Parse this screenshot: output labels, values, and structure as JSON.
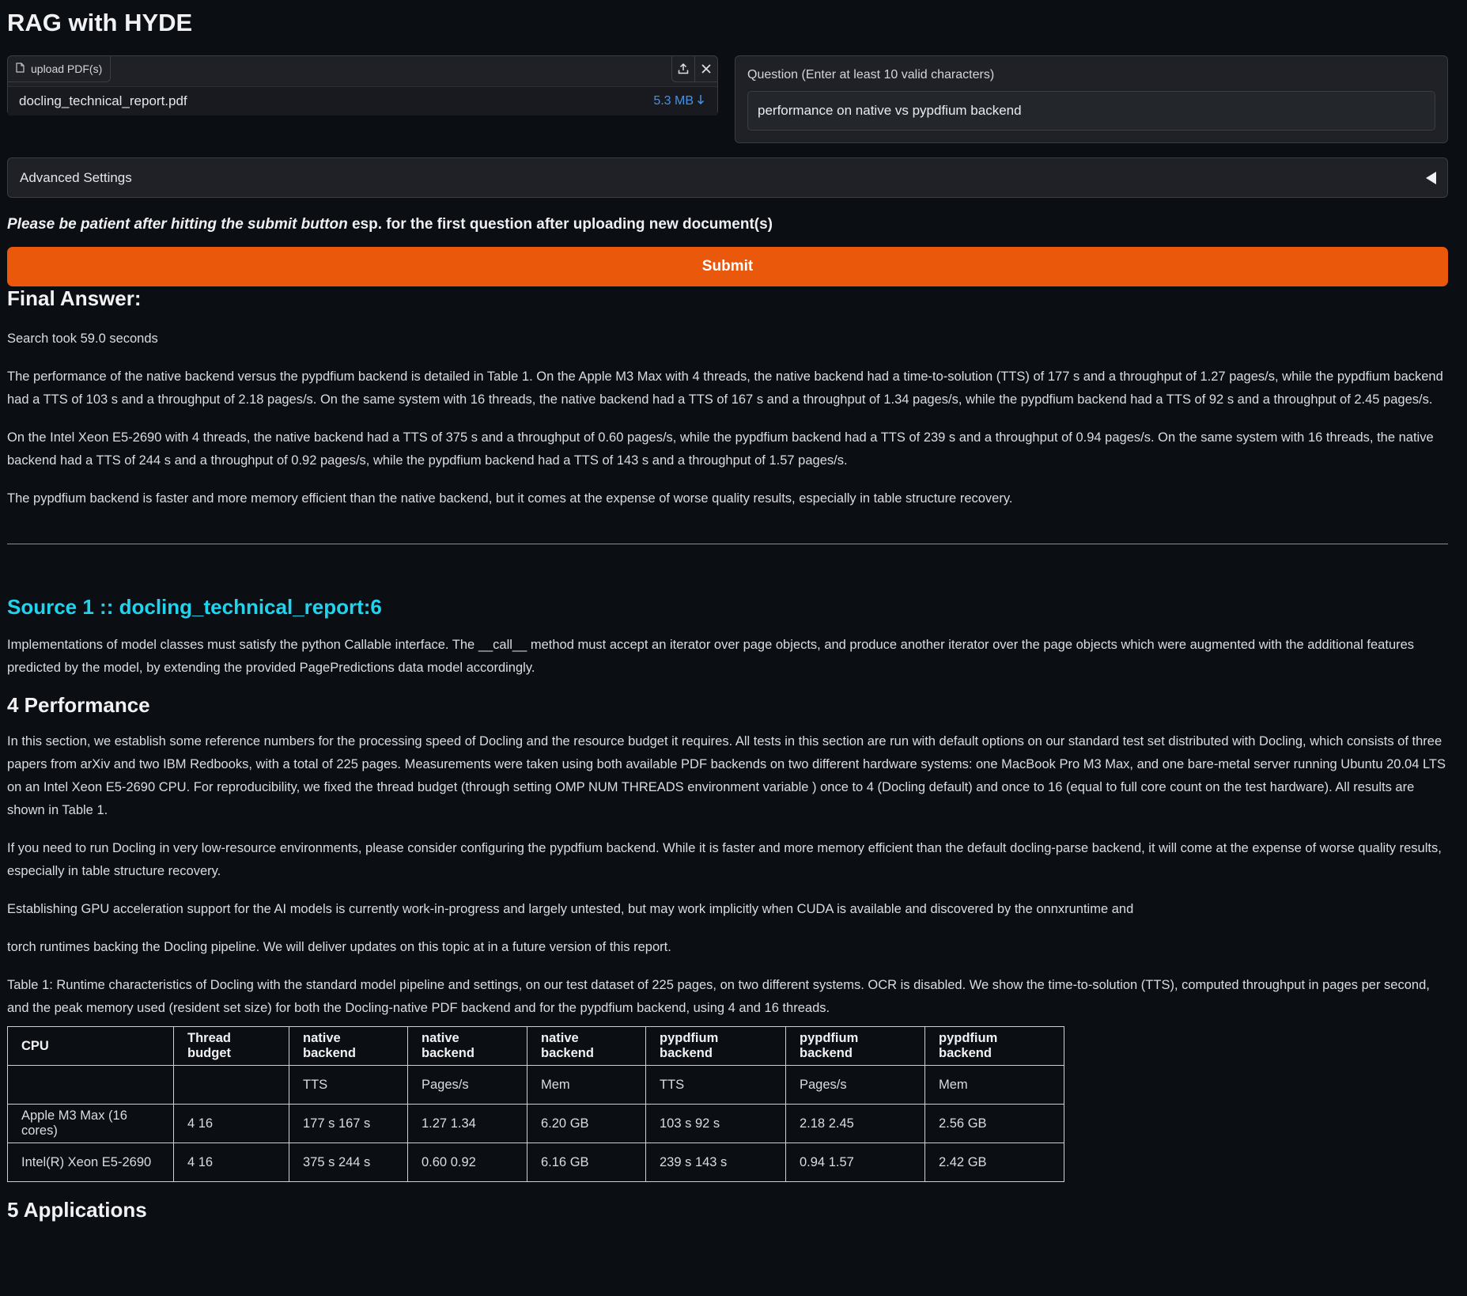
{
  "app": {
    "title": "RAG with HYDE"
  },
  "upload": {
    "tab_label": "upload PDF(s)",
    "file_name": "docling_technical_report.pdf",
    "file_size": "5.3 MB",
    "icons": [
      "file-icon",
      "upload-icon",
      "close-icon",
      "download-icon"
    ]
  },
  "question": {
    "label": "Question (Enter at least 10 valid characters)",
    "value": "performance on native vs pypdfium backend"
  },
  "advanced_settings": {
    "label": "Advanced Settings"
  },
  "notice": {
    "emphasis": "Please be patient after hitting the submit button",
    "rest": " esp. for the first question after uploading new document(s)"
  },
  "submit": {
    "label": "Submit",
    "color": "#ea580c"
  },
  "answer": {
    "heading": "Final Answer:",
    "search_time": "Search took 59.0 seconds",
    "paragraphs": [
      "The performance of the native backend versus the pypdfium backend is detailed in Table 1. On the Apple M3 Max with 4 threads, the native backend had a time-to-solution (TTS) of 177 s and a throughput of 1.27 pages/s, while the pypdfium backend had a TTS of 103 s and a throughput of 2.18 pages/s. On the same system with 16 threads, the native backend had a TTS of 167 s and a throughput of 1.34 pages/s, while the pypdfium backend had a TTS of 92 s and a throughput of 2.45 pages/s.",
      "On the Intel Xeon E5-2690 with 4 threads, the native backend had a TTS of 375 s and a throughput of 0.60 pages/s, while the pypdfium backend had a TTS of 239 s and a throughput of 0.94 pages/s. On the same system with 16 threads, the native backend had a TTS of 244 s and a throughput of 0.92 pages/s, while the pypdfium backend had a TTS of 143 s and a throughput of 1.57 pages/s.",
      "The pypdfium backend is faster and more memory efficient than the native backend, but it comes at the expense of worse quality results, especially in table structure recovery."
    ]
  },
  "source": {
    "title": "Source 1 :: docling_technical_report:6",
    "title_color": "#22d3ee",
    "intro": "Implementations of model classes must satisfy the python Callable interface. The __call__ method must accept an iterator over page objects, and produce another iterator over the page objects which were augmented with the additional features predicted by the model, by extending the provided PagePredictions data model accordingly.",
    "performance_heading": "4 Performance",
    "performance_paragraphs": [
      "In this section, we establish some reference numbers for the processing speed of Docling and the resource budget it requires. All tests in this section are run with default options on our standard test set distributed with Docling, which consists of three papers from arXiv and two IBM Redbooks, with a total of 225 pages. Measurements were taken using both available PDF backends on two different hardware systems: one MacBook Pro M3 Max, and one bare-metal server running Ubuntu 20.04 LTS on an Intel Xeon E5-2690 CPU. For reproducibility, we fixed the thread budget (through setting OMP NUM THREADS environment variable ) once to 4 (Docling default) and once to 16 (equal to full core count on the test hardware). All results are shown in Table 1.",
      "If you need to run Docling in very low-resource environments, please consider configuring the pypdfium backend. While it is faster and more memory efficient than the default docling-parse backend, it will come at the expense of worse quality results, especially in table structure recovery.",
      "Establishing GPU acceleration support for the AI models is currently work-in-progress and largely untested, but may work implicitly when CUDA is available and discovered by the onnxruntime and",
      "torch runtimes backing the Docling pipeline. We will deliver updates on this topic at in a future version of this report.",
      "Table 1: Runtime characteristics of Docling with the standard model pipeline and settings, on our test dataset of 225 pages, on two different systems. OCR is disabled. We show the time-to-solution (TTS), computed throughput in pages per second, and the peak memory used (resident set size) for both the Docling-native PDF backend and for the pypdfium backend, using 4 and 16 threads."
    ],
    "table": {
      "headers": [
        "CPU",
        "Thread budget",
        "native backend",
        "native backend",
        "native backend",
        "pypdfium backend",
        "pypdfium backend",
        "pypdfium backend"
      ],
      "rows": [
        [
          "",
          "",
          "TTS",
          "Pages/s",
          "Mem",
          "TTS",
          "Pages/s",
          "Mem"
        ],
        [
          "Apple M3 Max (16 cores)",
          "4 16",
          "177 s 167 s",
          "1.27 1.34",
          "6.20 GB",
          "103 s 92 s",
          "2.18 2.45",
          "2.56 GB"
        ],
        [
          "Intel(R) Xeon E5-2690",
          "4 16",
          "375 s 244 s",
          "0.60 0.92",
          "6.16 GB",
          "239 s 143 s",
          "0.94 1.57",
          "2.42 GB"
        ]
      ]
    },
    "applications_heading": "5 Applications"
  }
}
